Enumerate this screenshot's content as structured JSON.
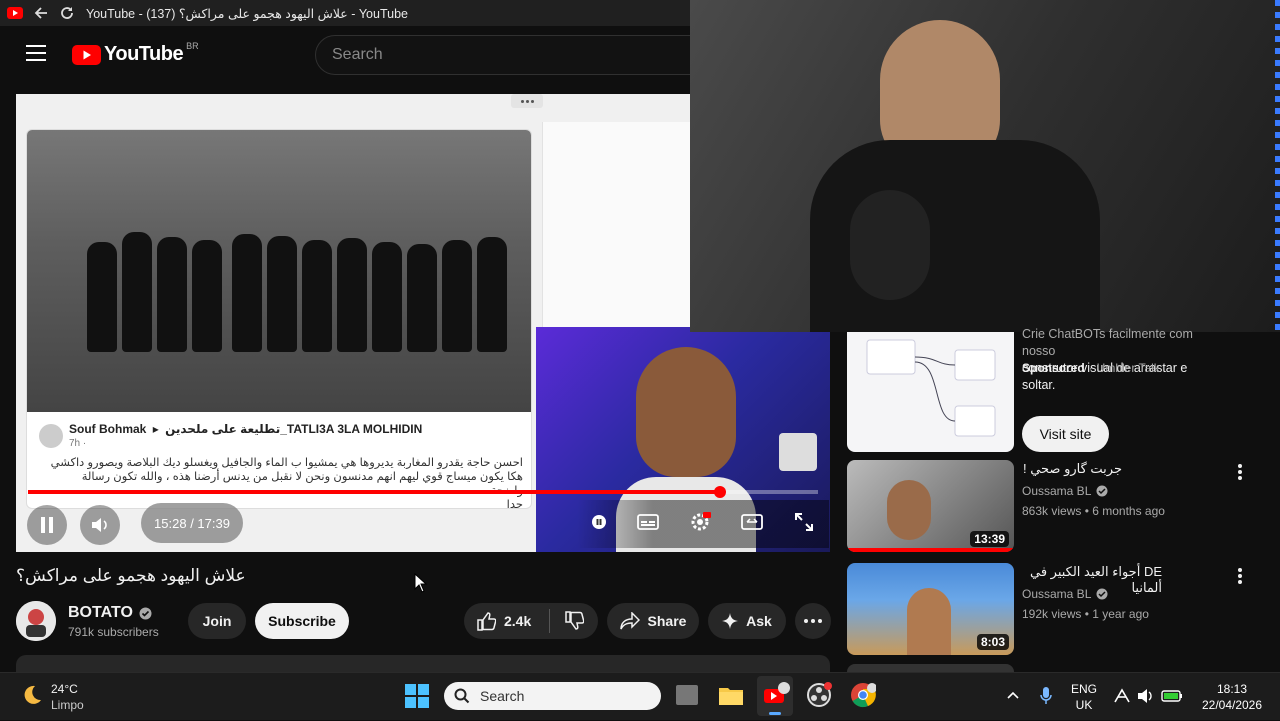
{
  "browser": {
    "tab_title": "YouTube - (137) علاش اليهود هجمو على مراكش؟ - YouTube"
  },
  "youtube": {
    "logo_text": "YouTube",
    "country_code": "BR",
    "search_placeholder": "Search"
  },
  "player": {
    "time": "15:28 / 17:39",
    "progress": 0.876,
    "fb_post": {
      "author": "Souf Bohmak",
      "group": "تطليعة على ملحدين_TATLI3A 3LA MOLHIDIN",
      "time": "7h · ",
      "text_line1": "احسن حاجة يقدرو المغاربة يديروها هي يمشيوا ب الماء والجافيل ويغسلو ديك البلاصة ويصورو داكشي",
      "text_line2": "هكا يكون ميساج قوي ليهم انهم مدنسون ونحن لا نقبل من يدنس أرضنا هذه ، والله تكون رسالة واضحة",
      "text_line3": "جدا"
    }
  },
  "video": {
    "title": "علاش اليهود هجمو على مراكش؟",
    "channel": "BOTATO",
    "subscribers": "791k subscribers",
    "join_label": "Join",
    "subscribe_label": "Subscribe",
    "likes": "2.4k",
    "share_label": "Share",
    "ask_label": "Ask"
  },
  "sidebar": {
    "ad": {
      "text_line1": "Crie ChatBOTs facilmente com nosso",
      "text_line2": "construtor visual de arrastar e soltar.",
      "sponsored_label": "Sponsored",
      "advertiser": "Umbler Talk",
      "cta": "Visit site"
    },
    "items": [
      {
        "title": "جربت گارو صحي !",
        "channel": "Oussama BL",
        "meta": "863k views • 6 months ago",
        "duration": "13:39"
      },
      {
        "title": "DE أجواء العيد الكبير في ألمانيا",
        "channel": "Oussama BL",
        "meta": "192k views • 1 year ago",
        "duration": "8:03"
      }
    ]
  },
  "taskbar": {
    "weather_temp": "24°C",
    "weather_desc": "Limpo",
    "search_label": "Search",
    "lang_line1": "ENG",
    "lang_line2": "UK",
    "clock_time": "18:13",
    "clock_date": "22/04/2026"
  },
  "colors": {
    "youtube_red": "#ff0000",
    "background": "#0f0f0f",
    "taskbar": "#1c1c1c"
  }
}
